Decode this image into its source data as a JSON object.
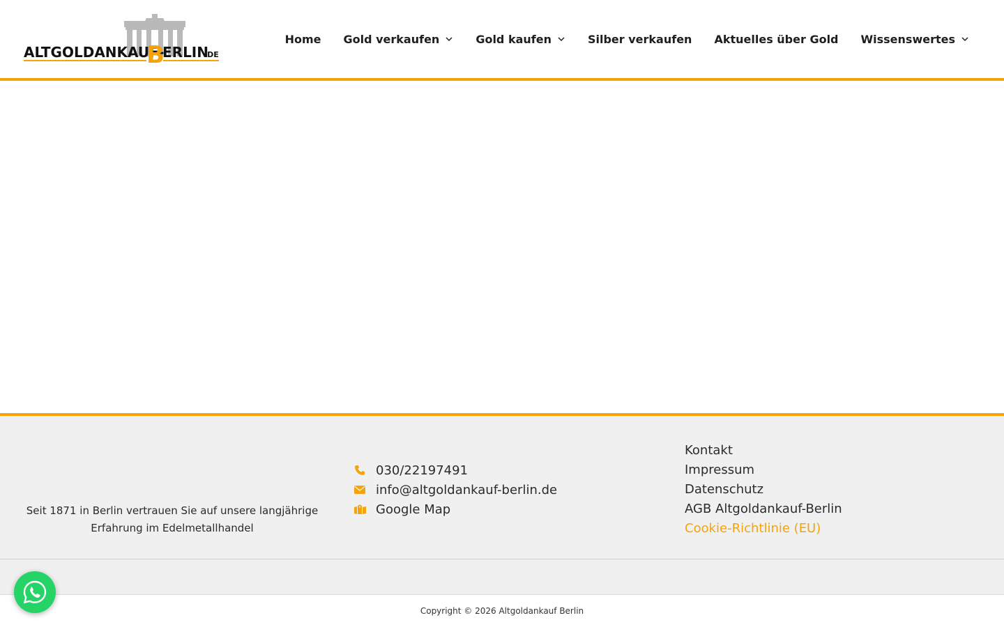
{
  "header": {
    "logo": {
      "text_main": "ALTGOLDANKAUF-",
      "text_accent": "B",
      "text_rest": "ERLIN",
      "text_tld": ".DE"
    },
    "nav": [
      {
        "label": "Home",
        "has_dropdown": false
      },
      {
        "label": "Gold verkaufen",
        "has_dropdown": true
      },
      {
        "label": "Gold kaufen",
        "has_dropdown": true
      },
      {
        "label": "Silber verkaufen",
        "has_dropdown": false
      },
      {
        "label": "Aktuelles über Gold",
        "has_dropdown": false
      },
      {
        "label": "Wissenswertes",
        "has_dropdown": true
      }
    ]
  },
  "footer": {
    "tagline_line1": "Seit 1871 in Berlin vertrauen Sie auf unsere langjährige",
    "tagline_line2": "Erfahrung im Edelmetallhandel",
    "contact": [
      {
        "icon": "phone-icon",
        "label": "030/22197491"
      },
      {
        "icon": "envelope-icon",
        "label": "info@altgoldankauf-berlin.de"
      },
      {
        "icon": "map-icon",
        "label": "Google Map"
      }
    ],
    "links": [
      {
        "label": "Kontakt",
        "accent": false
      },
      {
        "label": "Impressum",
        "accent": false
      },
      {
        "label": "Datenschutz",
        "accent": false
      },
      {
        "label": "AGB Altgoldankauf-Berlin",
        "accent": false
      },
      {
        "label": "Cookie-Richtlinie (EU)",
        "accent": true
      }
    ],
    "copyright": "Copyright © 2026 Altgoldankauf Berlin"
  },
  "colors": {
    "accent": "#f5a30b",
    "footer_bg": "#f0f0f0",
    "whatsapp": "#25d366"
  }
}
